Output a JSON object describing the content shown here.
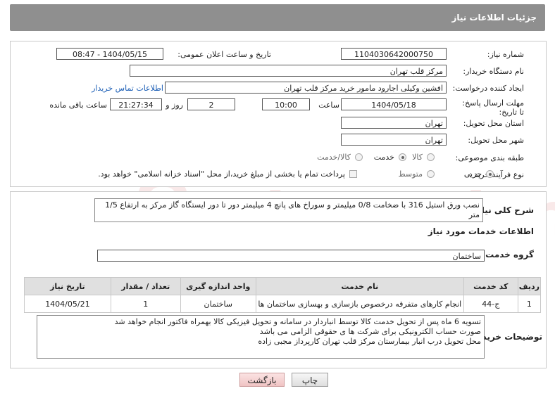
{
  "header": {
    "title": "جزئیات اطلاعات نیاز"
  },
  "fields": {
    "need_number": {
      "label": "شماره نیاز:",
      "value": "1104030642000750"
    },
    "announce": {
      "label": "تاریخ و ساعت اعلان عمومی:",
      "value": "1404/05/15 - 08:47"
    },
    "buyer_org": {
      "label": "نام دستگاه خریدار:",
      "value": "مرکز قلب تهران"
    },
    "requester": {
      "label": "ایجاد کننده درخواست:",
      "value": "افشین وکیلی اجارود مامور خرید مرکز قلب تهران",
      "contact_link": "اطلاعات تماس خریدار"
    },
    "deadline": {
      "label": "مهلت ارسال پاسخ: تا تاریخ:",
      "date": "1404/05/18",
      "time_label": "ساعت",
      "time": "10:00",
      "days": "2",
      "days_label": "روز و",
      "remaining": "21:27:34",
      "remaining_label": "ساعت باقی مانده"
    },
    "delivery_province": {
      "label": "استان محل تحویل:",
      "value": "تهران"
    },
    "delivery_city": {
      "label": "شهر محل تحویل:",
      "value": "تهران"
    },
    "category": {
      "label": "طبقه بندی موضوعی:",
      "options": [
        "کالا",
        "خدمت",
        "کالا/خدمت"
      ],
      "selected": "خدمت"
    },
    "process": {
      "label": "نوع فرآیند خرید :",
      "options": [
        "جزیی",
        "متوسط"
      ],
      "selected": "جزیی",
      "payment_note": "پرداخت تمام یا بخشی از مبلغ خرید،از محل \"اسناد خزانه اسلامی\" خواهد بود."
    }
  },
  "summary": {
    "label": "شرح کلی نیاز:",
    "text": "نصب ورق استیل 316 با ضخامت 0/8 میلیمتر و سوراخ های پانچ 4 میلیمتر دور تا دور ایستگاه گاز مرکز به ارتفاع 1/5 متر"
  },
  "services": {
    "heading": "اطلاعات خدمات مورد نیاز",
    "group_label": "گروه خدمت:",
    "group_value": "ساختمان",
    "columns": [
      "ردیف",
      "کد خدمت",
      "نام خدمت",
      "واحد اندازه گیری",
      "تعداد / مقدار",
      "تاریخ نیاز"
    ],
    "rows": [
      [
        "1",
        "ج-44",
        "انجام کارهای متفرقه درخصوص بازسازی و بهسازی ساختمان ها",
        "ساختمان",
        "1",
        "1404/05/21"
      ]
    ]
  },
  "buyer_notes": {
    "label": "توضیحات خریدار:",
    "text": "تسویه 6 ماه پس از تحویل خدمت کالا توسط انباردار در سامانه و تحویل فیزیکی کالا بهمراه فاکتور انجام خواهد شد\nصورت حساب الکترونیکی برای شرکت ها ی حقوقی الزامی می باشد\nمحل تحویل درب انبار بیمارستان مرکز قلب تهران کارپرداز مجبی زاده"
  },
  "buttons": {
    "print": "چاپ",
    "back": "بازگشت"
  },
  "watermark": "AriaTender.neT"
}
